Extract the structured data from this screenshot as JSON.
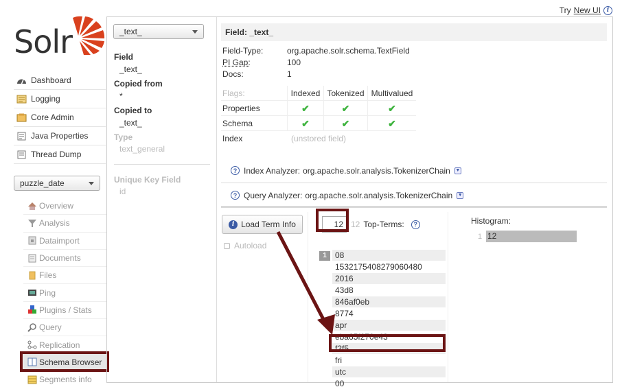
{
  "topbar": {
    "try_label": "Try",
    "new_ui_link": "New UI"
  },
  "logo": {
    "text": "Solr"
  },
  "main_nav": [
    {
      "label": "Dashboard",
      "icon": "dashboard-icon"
    },
    {
      "label": "Logging",
      "icon": "logging-icon"
    },
    {
      "label": "Core Admin",
      "icon": "core-admin-icon"
    },
    {
      "label": "Java Properties",
      "icon": "java-properties-icon"
    },
    {
      "label": "Thread Dump",
      "icon": "thread-dump-icon"
    }
  ],
  "core_selector": {
    "selected": "puzzle_date"
  },
  "core_nav": [
    {
      "label": "Overview",
      "icon": "overview-icon"
    },
    {
      "label": "Analysis",
      "icon": "analysis-icon"
    },
    {
      "label": "Dataimport",
      "icon": "dataimport-icon"
    },
    {
      "label": "Documents",
      "icon": "documents-icon"
    },
    {
      "label": "Files",
      "icon": "files-icon"
    },
    {
      "label": "Ping",
      "icon": "ping-icon"
    },
    {
      "label": "Plugins / Stats",
      "icon": "plugins-icon"
    },
    {
      "label": "Query",
      "icon": "query-icon"
    },
    {
      "label": "Replication",
      "icon": "replication-icon"
    },
    {
      "label": "Schema Browser",
      "icon": "schema-browser-icon"
    },
    {
      "label": "Segments info",
      "icon": "segments-icon"
    }
  ],
  "field_selector": {
    "selected": "_text_"
  },
  "field_props": {
    "field_label": "Field",
    "field_value": "_text_",
    "copied_from_label": "Copied from",
    "copied_from_value": "*",
    "copied_to_label": "Copied to",
    "copied_to_value": "_text_",
    "type_label": "Type",
    "type_value": "text_general",
    "unique_key_label": "Unique Key Field",
    "unique_key_value": "id"
  },
  "field_header": "Field: _text_",
  "field_details": {
    "field_type_label": "Field-Type:",
    "field_type_value": "org.apache.solr.schema.TextField",
    "pi_gap_label": "PI Gap:",
    "pi_gap_value": "100",
    "docs_label": "Docs:",
    "docs_value": "1"
  },
  "flags": {
    "header": [
      "Flags:",
      "Indexed",
      "Tokenized",
      "Multivalued"
    ],
    "properties_label": "Properties",
    "schema_label": "Schema",
    "index_label": "Index",
    "index_value": "(unstored field)"
  },
  "analyzers": {
    "index_label": "Index Analyzer:",
    "index_value": "org.apache.solr.analysis.TokenizerChain",
    "query_label": "Query Analyzer:",
    "query_value": "org.apache.solr.analysis.TokenizerChain"
  },
  "load_button": "Load Term Info",
  "autoload_label": "Autoload",
  "top_terms": {
    "count_value": "12",
    "count_max": "12",
    "label": "Top-Terms:",
    "badge": "1",
    "terms": [
      "08",
      "1532175408279060480",
      "2016",
      "43d8",
      "846af0eb",
      "8774",
      "apr",
      "eba65f270e43",
      "f2f5",
      "fri",
      "utc",
      "00"
    ]
  },
  "histogram": {
    "label": "Histogram:",
    "key": "1",
    "value": "12"
  },
  "colors": {
    "highlight": "#6b1414",
    "check": "#3db33d",
    "link": "#3b5ba5"
  }
}
